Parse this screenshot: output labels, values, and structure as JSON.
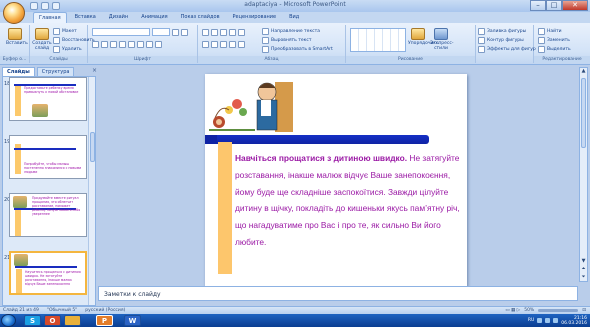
{
  "window": {
    "title": "adaptaciya - Microsoft PowerPoint",
    "min": "–",
    "max": "□",
    "close": "✕"
  },
  "ribbon_tabs": [
    "Главная",
    "Вставка",
    "Дизайн",
    "Анимация",
    "Показ слайдов",
    "Рецензирование",
    "Вид"
  ],
  "ribbon": {
    "clipboard": {
      "paste": "Вставить",
      "label": "Буфер о..."
    },
    "slides": {
      "create": "Создать слайд",
      "layout": "Макет",
      "reset": "Восстановить",
      "delete": "Удалить",
      "label": "Слайды"
    },
    "font": {
      "label": "Шрифт"
    },
    "paragraph": {
      "direction": "Направление текста",
      "align": "Выровнять текст",
      "smartart": "Преобразовать в SmartArt",
      "label": "Абзац"
    },
    "drawing": {
      "arrange": "Упорядочить",
      "styles": "Экспресс-стили",
      "fill": "Заливка фигуры",
      "outline": "Контур фигуры",
      "effects": "Эффекты для фигур",
      "label": "Рисование"
    },
    "editing": {
      "find": "Найти",
      "replace": "Заменить",
      "select": "Выделить",
      "label": "Редактирование"
    }
  },
  "panel": {
    "tab_slides": "Слайды",
    "tab_outline": "Структура",
    "close": "×"
  },
  "thumbnails": [
    {
      "num": "18",
      "text": "Предоставьте ребенку время привыкнуть к новой обстановке"
    },
    {
      "num": "19",
      "text": "Попробуйте, чтобы малыш постепенно знакомился с новыми людьми"
    },
    {
      "num": "20",
      "text": "Придумайте вместе ритуал прощания, это облегчит расставание, поможет ребенку почувствовать себя увереннее"
    },
    {
      "num": "21",
      "text": "Научитесь прощаться с дитиною швидко. Не затягуйте розставання, інакше малюк відчує Ваше занепокоєння"
    }
  ],
  "slide": {
    "lead": "Навчіться прощатися з дитиною швидко.",
    "body": " Не затягуйте розставання, інакше малюк  відчує Ваше занепокоєння, йому буде ще складніше заспокоїтися. Завжди цілуйте дитину в щічку, покладіть до кишеньки якусь пам’ятну річ, що нагадуватиме про Вас і про те, як сильно Ви його любите."
  },
  "notes": {
    "placeholder": "Заметки к слайду"
  },
  "status": {
    "slide": "Слайд 21 из 49",
    "theme": "\"Обычный 5\"",
    "lang": "русский (Россия)",
    "zoom": "50%"
  },
  "taskbar": {
    "items": [
      "S",
      "O",
      "P",
      "W"
    ],
    "lang": "RU",
    "time": "21:16",
    "date": "06.03.2016"
  },
  "colors": {
    "slide_text": "#9b1aa5",
    "accent_bar": "#1530c6",
    "side_bar": "#fdc66c"
  }
}
